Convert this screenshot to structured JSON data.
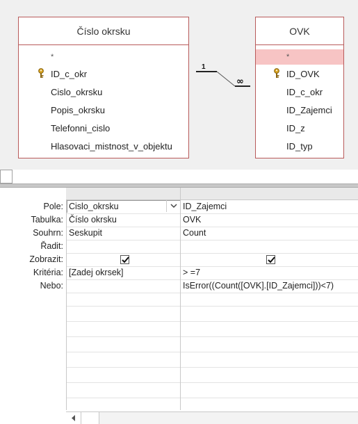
{
  "tables": [
    {
      "title": "Číslo okrsku",
      "fields": [
        {
          "name": "*",
          "key": false,
          "selected": false
        },
        {
          "name": "ID_c_okr",
          "key": true,
          "selected": false
        },
        {
          "name": "Cislo_okrsku",
          "key": false,
          "selected": false
        },
        {
          "name": "Popis_okrsku",
          "key": false,
          "selected": false
        },
        {
          "name": "Telefonni_cislo",
          "key": false,
          "selected": false
        },
        {
          "name": "Hlasovaci_mistnost_v_objektu",
          "key": false,
          "selected": false
        }
      ]
    },
    {
      "title": "OVK",
      "fields": [
        {
          "name": "*",
          "key": false,
          "selected": true
        },
        {
          "name": "ID_OVK",
          "key": true,
          "selected": false
        },
        {
          "name": "ID_c_okr",
          "key": false,
          "selected": false
        },
        {
          "name": "ID_Zajemci",
          "key": false,
          "selected": false
        },
        {
          "name": "ID_z",
          "key": false,
          "selected": false
        },
        {
          "name": "ID_typ",
          "key": false,
          "selected": false
        }
      ]
    }
  ],
  "relationship": {
    "one_label": "1",
    "many_label": "∞"
  },
  "grid": {
    "row_labels": [
      "Pole:",
      "Tabulka:",
      "Souhrn:",
      "Řadit:",
      "Zobrazit:",
      "Kritéria:",
      "Nebo:"
    ],
    "columns": [
      {
        "field": "Cislo_okrsku",
        "table": "Číslo okrsku",
        "total": "Seskupit",
        "sort": "",
        "show": true,
        "criteria": "[Zadej okrsek]",
        "or": ""
      },
      {
        "field": "ID_Zajemci",
        "table": "OVK",
        "total": "Count",
        "sort": "",
        "show": true,
        "criteria": "> =7",
        "or": "IsError((Count([OVK].[ID_Zajemci]))<7)"
      }
    ]
  },
  "icons": {
    "key": "key-icon",
    "dropdown": "chevron-down-icon",
    "checkbox": "checkmark-icon",
    "scroll_left": "arrow-left-icon"
  },
  "colors": {
    "table_border": "#b85a5a",
    "selected_row": "#f7c4c4",
    "key_gold": "#d9a520"
  }
}
